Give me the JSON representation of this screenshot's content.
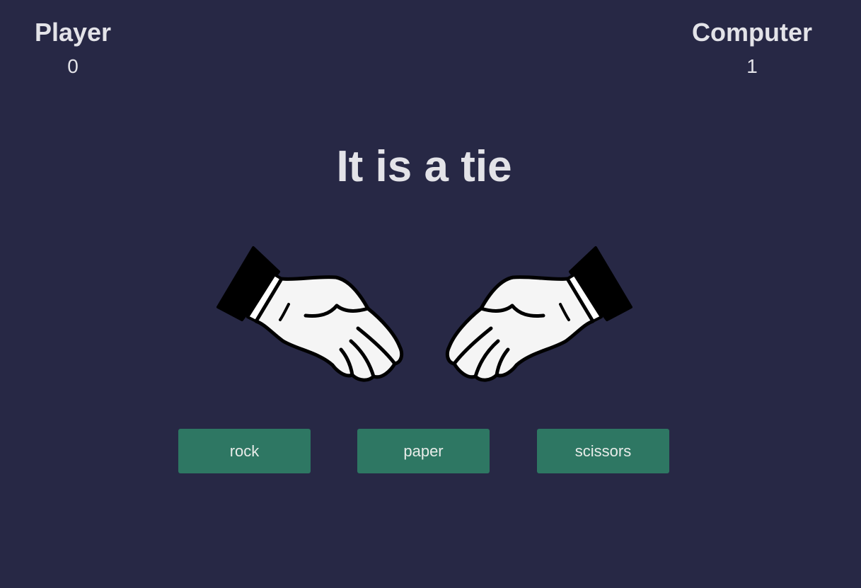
{
  "scoreboard": {
    "player": {
      "label": "Player",
      "score": "0"
    },
    "computer": {
      "label": "Computer",
      "score": "1"
    }
  },
  "result": {
    "message": "It is a tie"
  },
  "choice_image": {
    "icon": "handshake-icon"
  },
  "controls": {
    "rock": "rock",
    "paper": "paper",
    "scissors": "scissors"
  },
  "colors": {
    "background": "#272845",
    "text": "#e3e3e8",
    "button": "#2e7763"
  }
}
